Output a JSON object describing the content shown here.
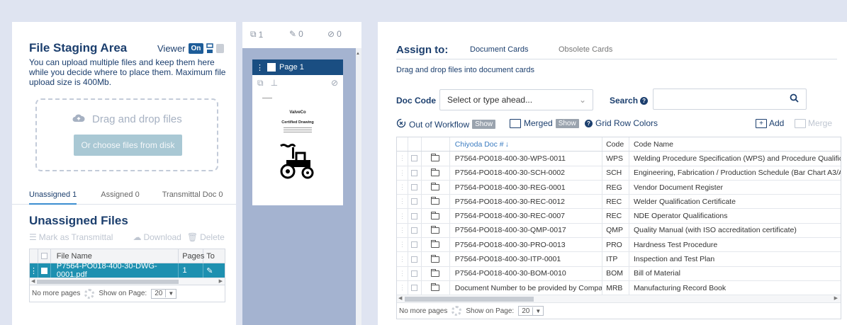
{
  "staging": {
    "title": "File Staging Area",
    "viewer_label": "Viewer",
    "viewer_state": "On",
    "description": "You can upload multiple files and keep them here while you decide where to place them. Maximum file upload size is 400Mb.",
    "dropzone_title": "Drag and drop files",
    "dropzone_button": "Or choose files from disk",
    "tabs": [
      "Unassigned 1",
      "Assigned 0",
      "Transmittal Doc 0"
    ],
    "unassigned_title": "Unassigned Files",
    "actions": {
      "mark": "Mark as Transmittal",
      "download": "Download",
      "delete": "Delete"
    },
    "table": {
      "headers": {
        "name": "File Name",
        "pages": "Pages",
        "to": "To"
      },
      "row": {
        "name": "P7564-PO018-400-30-DWG-0001.pdf",
        "pages": "1"
      }
    },
    "footer": {
      "no_more": "No more pages",
      "show_on_page": "Show on Page:",
      "page_size": "20"
    }
  },
  "pages_panel": {
    "count_pages": "1",
    "count_edit": "0",
    "count_excluded": "0",
    "page_label": "Page 1",
    "doc_company": "ValveCo",
    "doc_title": "Certified Drawing"
  },
  "assign": {
    "title": "Assign to:",
    "tab_active": "Document Cards",
    "tab_other": "Obsolete Cards",
    "hint": "Drag and drop files into document cards",
    "doc_code_label": "Doc Code",
    "doc_code_placeholder": "Select or type ahead...",
    "search_label": "Search",
    "out_of_workflow": "Out of Workflow",
    "merged": "Merged",
    "show": "Show",
    "grid_row_colors": "Grid Row Colors",
    "add": "Add",
    "merge": "Merge",
    "headers": {
      "doc": "Chiyoda Doc #",
      "code": "Code",
      "name": "Code Name"
    },
    "rows": [
      {
        "doc": "P7564-PO018-400-30-WPS-0011",
        "code": "WPS",
        "name": "Welding Procedure Specification (WPS) and Procedure Qualifica..."
      },
      {
        "doc": "P7564-PO018-400-30-SCH-0002",
        "code": "SCH",
        "name": "Engineering, Fabrication / Production Schedule (Bar Chart A3/A..."
      },
      {
        "doc": "P7564-PO018-400-30-REG-0001",
        "code": "REG",
        "name": "Vendor Document Register"
      },
      {
        "doc": "P7564-PO018-400-30-REC-0012",
        "code": "REC",
        "name": "Welder Qualification Certificate"
      },
      {
        "doc": "P7564-PO018-400-30-REC-0007",
        "code": "REC",
        "name": "NDE Operator Qualifications"
      },
      {
        "doc": "P7564-PO018-400-30-QMP-0017",
        "code": "QMP",
        "name": "Quality Manual (with ISO accreditation certificate)"
      },
      {
        "doc": "P7564-PO018-400-30-PRO-0013",
        "code": "PRO",
        "name": "Hardness Test Procedure"
      },
      {
        "doc": "P7564-PO018-400-30-ITP-0001",
        "code": "ITP",
        "name": "Inspection and Test Plan"
      },
      {
        "doc": "P7564-PO018-400-30-BOM-0010",
        "code": "BOM",
        "name": "Bill of Material"
      },
      {
        "doc": "Document Number to be provided by Company",
        "code": "MRB",
        "name": "Manufacturing Record Book"
      }
    ],
    "footer": {
      "no_more": "No more pages",
      "show_on_page": "Show on Page:",
      "page_size": "20"
    }
  },
  "colors": {
    "brand_navy": "#1c3f6e",
    "accent_blue": "#1e5d99",
    "selected_row": "#1e90b0",
    "panel_bg": "#a4b3d0"
  }
}
